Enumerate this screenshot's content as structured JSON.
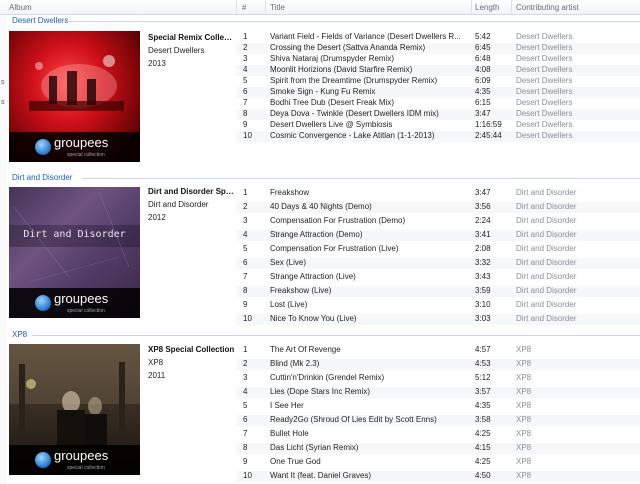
{
  "columns": {
    "album": "Album",
    "number": "#",
    "title": "Title",
    "length": "Length",
    "artist": "Contributing artist"
  },
  "sidebar_marks": [
    "s",
    "s"
  ],
  "groups": [
    {
      "label": "Desert Dwellers",
      "album": "Special Remix Collecti...",
      "artist": "Desert Dwellers",
      "year": "2013",
      "art_logo": "groupees",
      "art_logo_sub": "special collection",
      "art_caption": "",
      "tracks": [
        {
          "n": "1",
          "title": "Variant Field - Fields of Variance (Desert Dwellers R...",
          "length": "5:42",
          "artist": "Desert Dwellers"
        },
        {
          "n": "2",
          "title": "Crossing the Desert (Sattva Ananda Remix)",
          "length": "6:45",
          "artist": "Desert Dwellers"
        },
        {
          "n": "3",
          "title": "Shiva Nataraj (Drumspyder Remix)",
          "length": "6:48",
          "artist": "Desert Dwellers"
        },
        {
          "n": "4",
          "title": "Moonlit Horizions (David Starfire Remix)",
          "length": "4:08",
          "artist": "Desert Dwellers"
        },
        {
          "n": "5",
          "title": "Spirit from the Dreamtime (Drumspyder Remix)",
          "length": "6:09",
          "artist": "Desert Dwellers"
        },
        {
          "n": "6",
          "title": "Smoke Sign - Kung Fu Remix",
          "length": "4:35",
          "artist": "Desert Dwellers"
        },
        {
          "n": "7",
          "title": "Bodhi Tree Dub (Desert Freak Mix)",
          "length": "6:15",
          "artist": "Desert Dwellers"
        },
        {
          "n": "8",
          "title": "Deya Dova - Twinkle (Desert Dwellers IDM mix)",
          "length": "3:47",
          "artist": "Desert Dwellers"
        },
        {
          "n": "9",
          "title": "Desert Dwellers Live @ Symbiosis",
          "length": "1:16:59",
          "artist": "Desert Dwellers"
        },
        {
          "n": "10",
          "title": "Cosmic Convergence - Lake Atitlan (1-1-2013)",
          "length": "2:45:44",
          "artist": "Desert Dwellers"
        }
      ]
    },
    {
      "label": "Dirt and Disorder",
      "album": "Dirt and Disorder Spe...",
      "artist": "Dirt and Disorder",
      "year": "2012",
      "art_logo": "groupees",
      "art_logo_sub": "special collection",
      "art_caption": "Dirt and Disorder",
      "tracks": [
        {
          "n": "1",
          "title": "Freakshow",
          "length": "3:47",
          "artist": "Dirt and Disorder"
        },
        {
          "n": "2",
          "title": "40 Days & 40 Nights (Demo)",
          "length": "3:56",
          "artist": "Dirt and Disorder"
        },
        {
          "n": "3",
          "title": "Compensation For Frustration (Demo)",
          "length": "2:24",
          "artist": "Dirt and Disorder"
        },
        {
          "n": "4",
          "title": "Strange Attraction (Demo)",
          "length": "3:41",
          "artist": "Dirt and Disorder"
        },
        {
          "n": "5",
          "title": "Compensation For Frustration (Live)",
          "length": "2:08",
          "artist": "Dirt and Disorder"
        },
        {
          "n": "6",
          "title": "Sex (Live)",
          "length": "3:32",
          "artist": "Dirt and Disorder"
        },
        {
          "n": "7",
          "title": "Strange Attraction (Live)",
          "length": "3:43",
          "artist": "Dirt and Disorder"
        },
        {
          "n": "8",
          "title": "Freakshow (Live)",
          "length": "3:59",
          "artist": "Dirt and Disorder"
        },
        {
          "n": "9",
          "title": "Lost (Live)",
          "length": "3:10",
          "artist": "Dirt and Disorder"
        },
        {
          "n": "10",
          "title": "Nice To Know You (Live)",
          "length": "3:03",
          "artist": "Dirt and Disorder"
        }
      ]
    },
    {
      "label": "XP8",
      "album": "XP8 Special Collection",
      "artist": "XP8",
      "year": "2011",
      "art_logo": "groupees",
      "art_logo_sub": "special collection",
      "art_caption": "",
      "tracks": [
        {
          "n": "1",
          "title": "The Art Of Revenge",
          "length": "4:57",
          "artist": "XP8"
        },
        {
          "n": "2",
          "title": "Blind (Mk 2.3)",
          "length": "4:53",
          "artist": "XP8"
        },
        {
          "n": "3",
          "title": "Cuttin'n'Drinkin (Grendel Remix)",
          "length": "5:12",
          "artist": "XP8"
        },
        {
          "n": "4",
          "title": "Lies (Dope Stars Inc Remix)",
          "length": "3:57",
          "artist": "XP8"
        },
        {
          "n": "5",
          "title": "I See Her",
          "length": "4:35",
          "artist": "XP8"
        },
        {
          "n": "6",
          "title": "Ready2Go (Shroud Of Lies Edit by Scott Enns)",
          "length": "3:58",
          "artist": "XP8"
        },
        {
          "n": "7",
          "title": "Bullet Hole",
          "length": "4:25",
          "artist": "XP8"
        },
        {
          "n": "8",
          "title": "Das Licht (Syrian Remix)",
          "length": "4:15",
          "artist": "XP8"
        },
        {
          "n": "9",
          "title": "One True God",
          "length": "4:25",
          "artist": "XP8"
        },
        {
          "n": "10",
          "title": "Want It (feat. Daniel Graves)",
          "length": "4:50",
          "artist": "XP8"
        }
      ]
    }
  ],
  "colors": {
    "group_label": "#1e5fb4",
    "artist_text": "#8a8f96",
    "header_text": "#666e7a"
  }
}
